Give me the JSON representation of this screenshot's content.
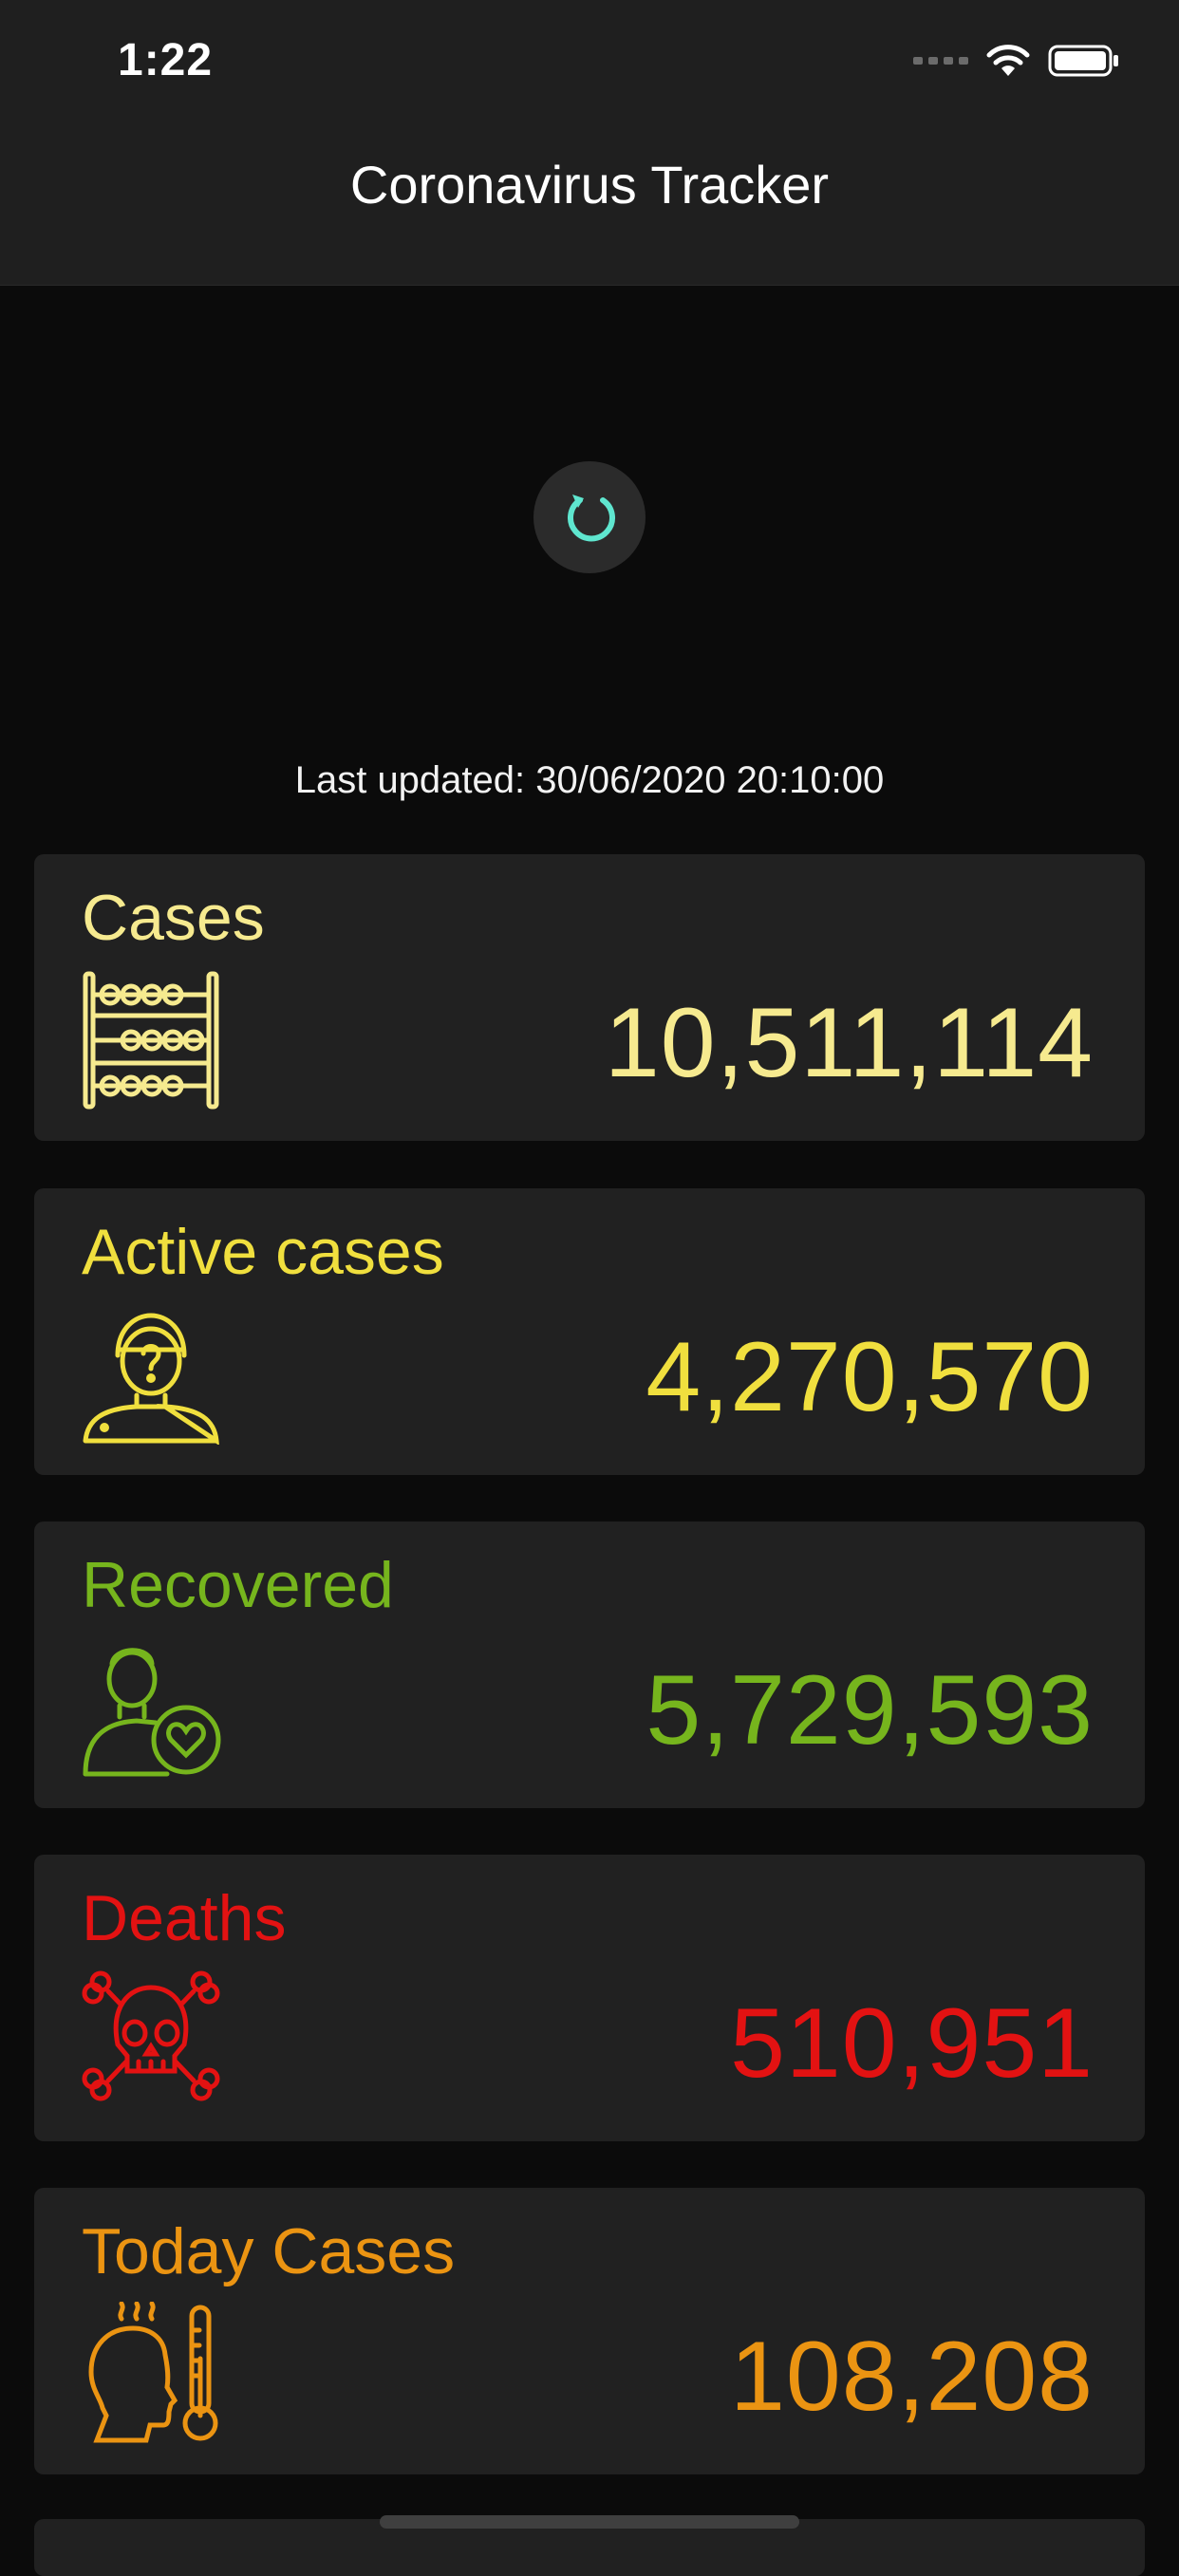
{
  "status_bar": {
    "time": "1:22"
  },
  "nav": {
    "title": "Coronavirus Tracker"
  },
  "last_updated": "Last updated: 30/06/2020 20:10:00",
  "cards": [
    {
      "title": "Cases",
      "value": "10,511,114",
      "color": "#f6ea8f",
      "icon": "abacus-icon"
    },
    {
      "title": "Active cases",
      "value": "4,270,570",
      "color": "#f0df3e",
      "icon": "person-question-icon"
    },
    {
      "title": "Recovered",
      "value": "5,729,593",
      "color": "#76b51d",
      "icon": "person-heart-icon"
    },
    {
      "title": "Deaths",
      "value": "510,951",
      "color": "#e31212",
      "icon": "skull-crossbones-icon"
    },
    {
      "title": "Today Cases",
      "value": "108,208",
      "color": "#eb9412",
      "icon": "fever-thermometer-icon"
    }
  ],
  "colors": {
    "refresh_accent": "#5fe6cf",
    "background": "#0b0b0b",
    "card": "#212121"
  }
}
